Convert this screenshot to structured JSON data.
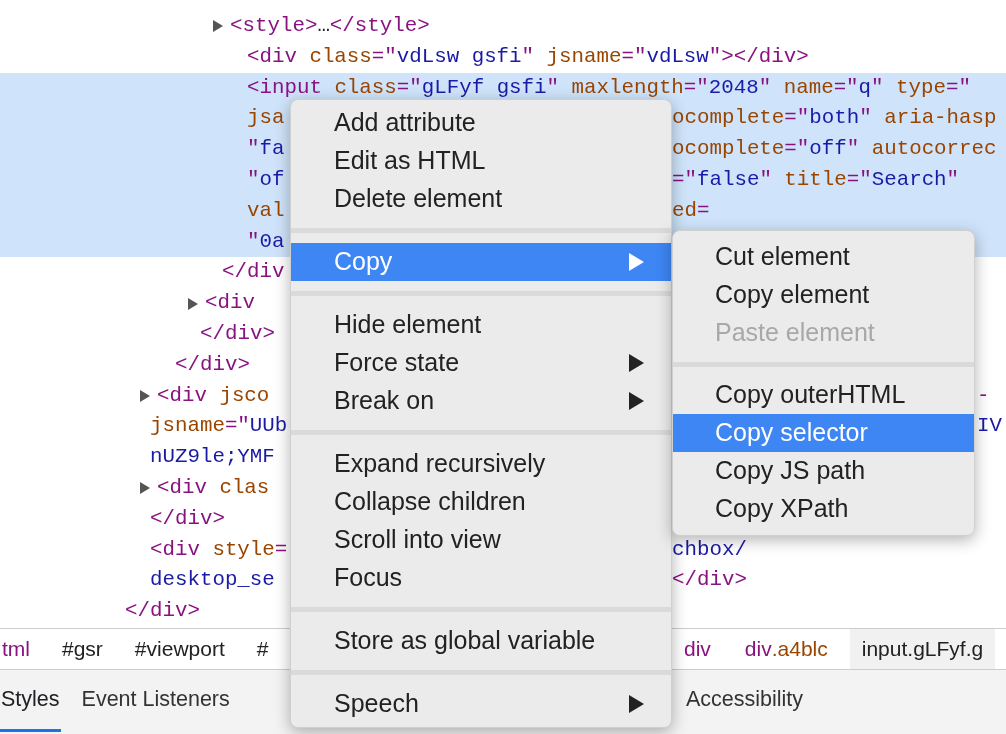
{
  "code_lines": [
    {
      "expandable": true,
      "selected": false,
      "left": [
        {
          "kind": "tag",
          "text": "<style>"
        },
        {
          "kind": "text",
          "text": "…"
        },
        {
          "kind": "tag",
          "text": "</style>"
        }
      ]
    },
    {
      "expandable": false,
      "selected": false,
      "left": [
        {
          "kind": "tag",
          "text": "<div "
        },
        {
          "kind": "attr",
          "text": "class"
        },
        {
          "kind": "tag",
          "text": "=\""
        },
        {
          "kind": "value",
          "text": "vdLsw gsfi"
        },
        {
          "kind": "tag",
          "text": "\" "
        },
        {
          "kind": "attr",
          "text": "jsname"
        },
        {
          "kind": "tag",
          "text": "=\""
        },
        {
          "kind": "value",
          "text": "vdLsw"
        },
        {
          "kind": "tag",
          "text": "\"></div>"
        }
      ]
    },
    {
      "expandable": false,
      "selected": true,
      "left": [
        {
          "kind": "tag",
          "text": "<input "
        },
        {
          "kind": "attr",
          "text": "class"
        },
        {
          "kind": "tag",
          "text": "=\""
        },
        {
          "kind": "value",
          "text": "gLFyf gsfi"
        },
        {
          "kind": "tag",
          "text": "\" "
        },
        {
          "kind": "attr",
          "text": "maxlength"
        },
        {
          "kind": "tag",
          "text": "=\""
        },
        {
          "kind": "value",
          "text": "2048"
        },
        {
          "kind": "tag",
          "text": "\" "
        },
        {
          "kind": "attr",
          "text": "name"
        },
        {
          "kind": "tag",
          "text": "=\""
        },
        {
          "kind": "value",
          "text": "q"
        },
        {
          "kind": "tag",
          "text": "\" "
        },
        {
          "kind": "attr",
          "text": "type"
        },
        {
          "kind": "tag",
          "text": "=\""
        }
      ]
    },
    {
      "expandable": false,
      "selected": true,
      "left": [
        {
          "kind": "attr",
          "text": "jsa"
        }
      ],
      "right": [
        {
          "kind": "attr",
          "text": "ocomplete"
        },
        {
          "kind": "tag",
          "text": "=\""
        },
        {
          "kind": "value",
          "text": "both"
        },
        {
          "kind": "tag",
          "text": "\" "
        },
        {
          "kind": "attr",
          "text": "aria-hasp"
        }
      ]
    },
    {
      "expandable": false,
      "selected": true,
      "left": [
        {
          "kind": "tag",
          "text": "\""
        },
        {
          "kind": "value",
          "text": "fa"
        }
      ],
      "right": [
        {
          "kind": "attr",
          "text": "ocomplete"
        },
        {
          "kind": "tag",
          "text": "=\""
        },
        {
          "kind": "value",
          "text": "off"
        },
        {
          "kind": "tag",
          "text": "\" "
        },
        {
          "kind": "attr",
          "text": "autocorrec"
        }
      ]
    },
    {
      "expandable": false,
      "selected": true,
      "left": [
        {
          "kind": "tag",
          "text": "\""
        },
        {
          "kind": "value",
          "text": "of"
        }
      ],
      "right": [
        {
          "kind": "tag",
          "text": "=\""
        },
        {
          "kind": "value",
          "text": "false"
        },
        {
          "kind": "tag",
          "text": "\" "
        },
        {
          "kind": "attr",
          "text": "title"
        },
        {
          "kind": "tag",
          "text": "=\""
        },
        {
          "kind": "value",
          "text": "Search"
        },
        {
          "kind": "tag",
          "text": "\""
        }
      ]
    },
    {
      "expandable": false,
      "selected": true,
      "left": [
        {
          "kind": "attr",
          "text": "val"
        }
      ],
      "right": [
        {
          "kind": "attr",
          "text": "ed"
        },
        {
          "kind": "tag",
          "text": "="
        }
      ]
    },
    {
      "expandable": false,
      "selected": true,
      "left": [
        {
          "kind": "tag",
          "text": "\""
        },
        {
          "kind": "value",
          "text": "0a"
        }
      ]
    },
    {
      "expandable": false,
      "selected": false,
      "left": [
        {
          "kind": "tag",
          "text": "</div"
        }
      ]
    },
    {
      "expandable": true,
      "selected": false,
      "left": [
        {
          "kind": "tag",
          "text": "<div"
        }
      ]
    },
    {
      "expandable": false,
      "selected": false,
      "left": [
        {
          "kind": "tag",
          "text": "</div>"
        }
      ]
    },
    {
      "expandable": false,
      "selected": false,
      "left": [
        {
          "kind": "tag",
          "text": "</div>"
        }
      ]
    },
    {
      "expandable": true,
      "selected": false,
      "left": [
        {
          "kind": "tag",
          "text": "<div "
        },
        {
          "kind": "attr",
          "text": "jsco"
        }
      ],
      "far": [
        {
          "kind": "tag",
          "text": "-"
        }
      ]
    },
    {
      "expandable": false,
      "selected": false,
      "left": [
        {
          "kind": "attr",
          "text": "jsname"
        },
        {
          "kind": "tag",
          "text": "=\""
        },
        {
          "kind": "value",
          "text": "UUb"
        }
      ],
      "far": [
        {
          "kind": "value",
          "text": "IV"
        }
      ]
    },
    {
      "expandable": false,
      "selected": false,
      "left": [
        {
          "kind": "value",
          "text": "nUZ9le;YMF"
        }
      ]
    },
    {
      "expandable": true,
      "selected": false,
      "left": [
        {
          "kind": "tag",
          "text": "<div "
        },
        {
          "kind": "attr",
          "text": "clas"
        }
      ]
    },
    {
      "expandable": false,
      "selected": false,
      "left": [
        {
          "kind": "tag",
          "text": "</div>"
        }
      ]
    },
    {
      "expandable": false,
      "selected": false,
      "left": [
        {
          "kind": "tag",
          "text": "<div "
        },
        {
          "kind": "attr",
          "text": "style"
        },
        {
          "kind": "tag",
          "text": "="
        }
      ],
      "right": [
        {
          "kind": "value",
          "text": "chbox/"
        }
      ]
    },
    {
      "expandable": false,
      "selected": false,
      "left": [
        {
          "kind": "value",
          "text": "desktop_se"
        }
      ],
      "right": [
        {
          "kind": "tag",
          "text": "</div>"
        }
      ]
    },
    {
      "expandable": false,
      "selected": false,
      "left": [
        {
          "kind": "tag",
          "text": "</div>"
        }
      ]
    }
  ],
  "breadcrumbs_left": [
    {
      "selected": false,
      "tokens": [
        {
          "kind": "tag",
          "text": "tml"
        }
      ]
    },
    {
      "selected": false,
      "tokens": [
        {
          "kind": "text",
          "text": "#gsr"
        }
      ]
    },
    {
      "selected": false,
      "tokens": [
        {
          "kind": "text",
          "text": "#viewport"
        }
      ]
    },
    {
      "selected": false,
      "tokens": [
        {
          "kind": "text",
          "text": "#"
        }
      ]
    }
  ],
  "breadcrumbs_right": [
    {
      "selected": false,
      "tokens": [
        {
          "kind": "tag",
          "text": "div"
        }
      ]
    },
    {
      "selected": false,
      "tokens": [
        {
          "kind": "tag",
          "text": "div"
        },
        {
          "kind": "attr",
          "text": ".a4blc"
        }
      ]
    },
    {
      "selected": true,
      "tokens": [
        {
          "kind": "text",
          "text": "input.gLFyf.g"
        }
      ]
    }
  ],
  "tabs_left": [
    {
      "label": "Styles",
      "selected": true
    },
    {
      "label": "Event Listeners",
      "selected": false
    }
  ],
  "tabs_right": [
    {
      "label": "Accessibility",
      "selected": false
    }
  ],
  "context_menu": {
    "sections": [
      {
        "items": [
          {
            "label": "Add attribute",
            "submenu": false,
            "selected": false
          },
          {
            "label": "Edit as HTML",
            "submenu": false,
            "selected": false
          },
          {
            "label": "Delete element",
            "submenu": false,
            "selected": false
          }
        ]
      },
      {
        "items": [
          {
            "label": "Copy",
            "submenu": true,
            "selected": true
          }
        ]
      },
      {
        "items": [
          {
            "label": "Hide element",
            "submenu": false,
            "selected": false
          },
          {
            "label": "Force state",
            "submenu": true,
            "selected": false
          },
          {
            "label": "Break on",
            "submenu": true,
            "selected": false
          }
        ]
      },
      {
        "items": [
          {
            "label": "Expand recursively",
            "submenu": false,
            "selected": false
          },
          {
            "label": "Collapse children",
            "submenu": false,
            "selected": false
          },
          {
            "label": "Scroll into view",
            "submenu": false,
            "selected": false
          },
          {
            "label": "Focus",
            "submenu": false,
            "selected": false
          }
        ]
      },
      {
        "items": [
          {
            "label": "Store as global variable",
            "submenu": false,
            "selected": false
          }
        ]
      },
      {
        "items": [
          {
            "label": "Speech",
            "submenu": true,
            "selected": false
          }
        ]
      }
    ]
  },
  "copy_submenu": {
    "sections": [
      {
        "items": [
          {
            "label": "Cut element",
            "selected": false,
            "disabled": false
          },
          {
            "label": "Copy element",
            "selected": false,
            "disabled": false
          },
          {
            "label": "Paste element",
            "selected": false,
            "disabled": true
          }
        ]
      },
      {
        "items": [
          {
            "label": "Copy outerHTML",
            "selected": false,
            "disabled": false
          },
          {
            "label": "Copy selector",
            "selected": true,
            "disabled": false
          },
          {
            "label": "Copy JS path",
            "selected": false,
            "disabled": false
          },
          {
            "label": "Copy XPath",
            "selected": false,
            "disabled": false
          }
        ]
      }
    ]
  }
}
